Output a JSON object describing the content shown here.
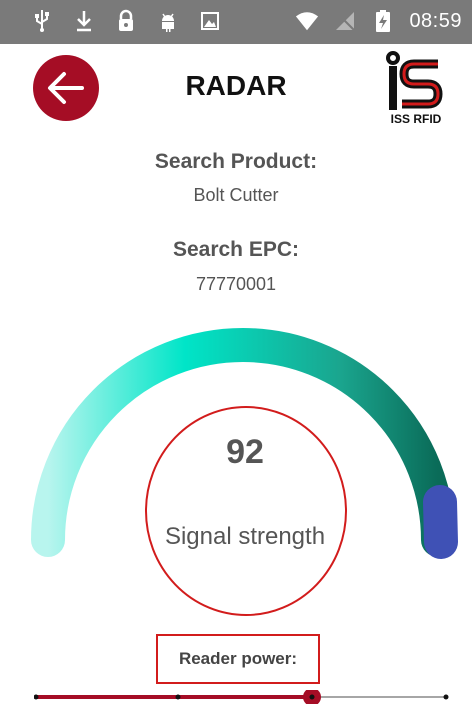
{
  "status_bar": {
    "time": "08:59",
    "icons_left": [
      "usb-icon",
      "download-icon",
      "lock-icon",
      "android-icon",
      "image-icon"
    ],
    "icons_right": [
      "wifi-icon",
      "no-signal-icon",
      "battery-charging-icon"
    ]
  },
  "header": {
    "title": "RADAR",
    "logo_text": "ISS RFID",
    "back_color": "#a50d25"
  },
  "product": {
    "label": "Search Product:",
    "value": "Bolt Cutter"
  },
  "epc": {
    "label": "Search EPC:",
    "value": "77770001"
  },
  "signal": {
    "value": "92",
    "label": "Signal strength",
    "level": 0.92,
    "colors": [
      "#b8f5ee",
      "#00e5c8",
      "#0a7a66",
      "#3f51b5"
    ]
  },
  "reader_power": {
    "label": "Reader power:",
    "level": 0.66,
    "accent": "#a50d25"
  }
}
